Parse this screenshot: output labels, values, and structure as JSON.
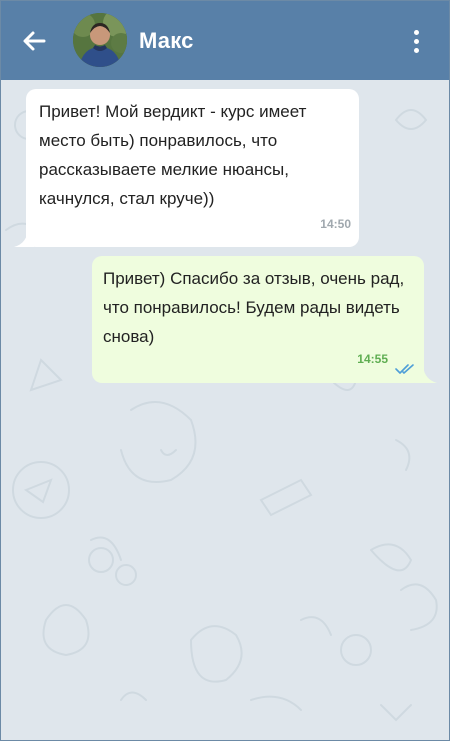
{
  "header": {
    "contact_name": "Макс",
    "back_icon": "arrow-left-icon",
    "menu_icon": "more-vertical-icon"
  },
  "messages": [
    {
      "direction": "incoming",
      "text": "Привет! Мой вердикт - курс имеет место быть) понравилось, что рассказываете мелкие нюансы, качнулся, стал круче))",
      "time": "14:50"
    },
    {
      "direction": "outgoing",
      "text": "Привет) Спасибо за отзыв, очень рад, что понравилось! Будем рады видеть снова)",
      "time": "14:55",
      "status_icon": "double-check-icon"
    }
  ],
  "colors": {
    "header": "#5880a8",
    "chat_background": "#dfe6ec",
    "incoming_bubble": "#ffffff",
    "outgoing_bubble": "#effdde",
    "outgoing_time": "#5fae52",
    "read_check": "#4e9ed8"
  }
}
